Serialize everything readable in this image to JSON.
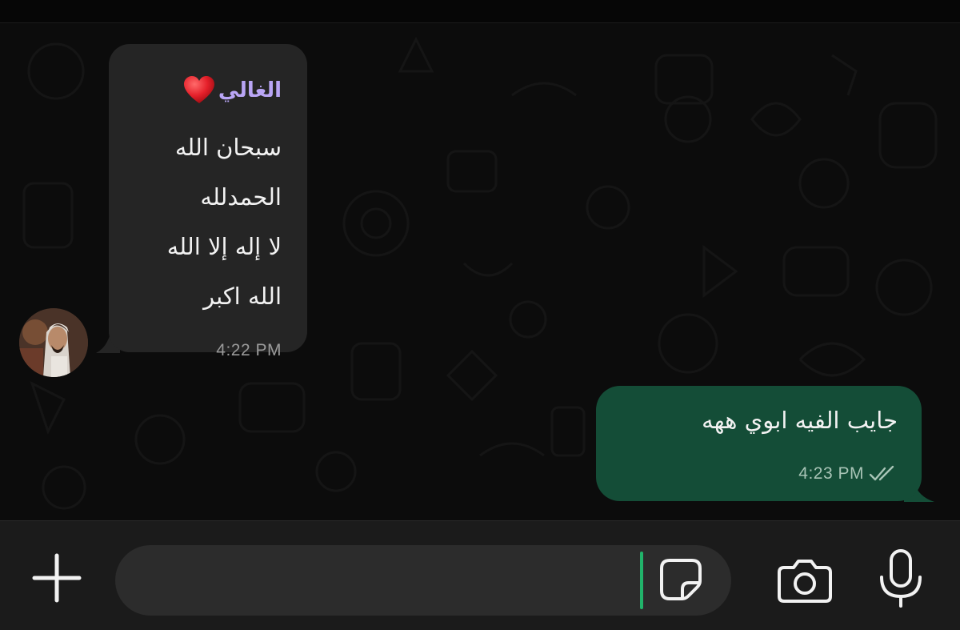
{
  "theme": {
    "incoming_bubble_color": "#252525",
    "outgoing_bubble_color": "#144d37",
    "sender_name_color": "#b9a5f5",
    "cursor_color": "#21b36a"
  },
  "messages": [
    {
      "direction": "incoming",
      "sender": "الغالي",
      "sender_emoji_icon": "red-heart-icon",
      "lines": [
        "سبحان الله",
        "الحمدلله",
        "لا إله إلا الله",
        "الله اكبر"
      ],
      "time": "4:22 PM",
      "avatar_icon": "contact-avatar-photo"
    },
    {
      "direction": "outgoing",
      "text": "جايب الفيه ابوي ههه",
      "time": "4:23 PM",
      "status_icon": "double-check-icon"
    }
  ],
  "input_bar": {
    "attach_icon": "plus-icon",
    "message_value": "",
    "sticker_icon": "sticker-icon",
    "camera_icon": "camera-icon",
    "mic_icon": "microphone-icon"
  }
}
